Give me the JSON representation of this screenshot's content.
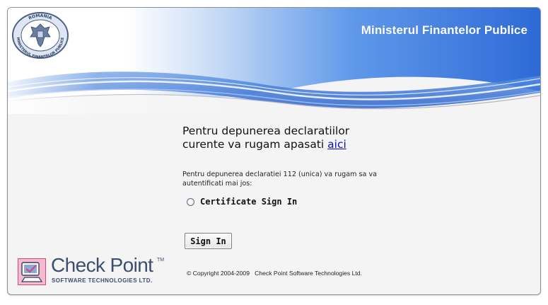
{
  "banner": {
    "ministry_title": "Ministerul Finantelor Publice",
    "seal_top_text": "ROMANIA",
    "seal_bottom_text": "MINISTERUL FINANTELOR PUBLICE"
  },
  "main": {
    "heading_line1": "Pentru depunerea declaratiilor",
    "heading_line2": "curente va rugam apasati",
    "heading_link": "aici",
    "note": "Pentru depunerea declaratiei 112 (unica) va rugam sa va autentificati mai jos:",
    "radio_label": "Certificate Sign In",
    "signin_button": "Sign In"
  },
  "footer": {
    "vendor_name": "Check Point",
    "vendor_tm": "TM",
    "vendor_subtitle": "SOFTWARE TECHNOLOGIES LTD.",
    "copyright": "© Copyright 2004-2009   Check Point Software Technologies Ltd."
  },
  "colors": {
    "banner_blue": "#2f6fd6",
    "link": "#1010b0",
    "vendor_text": "#3d4f6e",
    "vendor_logo_pink": "#e85c8a"
  },
  "icons": [
    "romania-seal-icon",
    "check-point-logo-icon",
    "radio-icon"
  ]
}
